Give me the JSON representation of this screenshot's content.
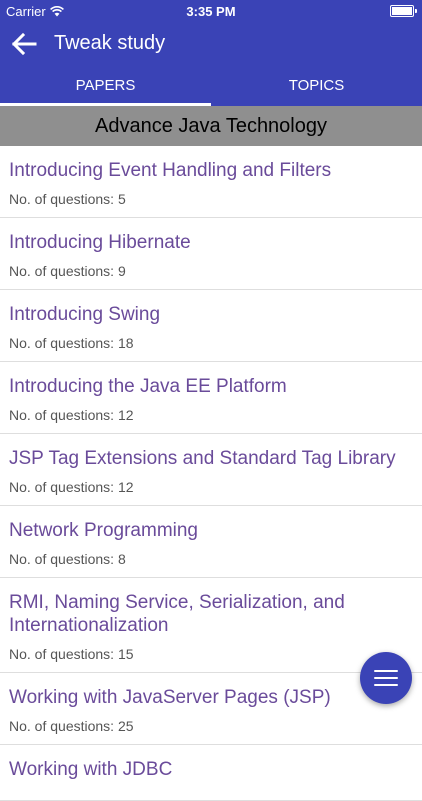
{
  "status_bar": {
    "carrier": "Carrier",
    "time": "3:35 PM"
  },
  "app_bar": {
    "title": "Tweak study",
    "back_icon": "arrow-left-icon"
  },
  "tabs": [
    {
      "label": "PAPERS",
      "active": true
    },
    {
      "label": "TOPICS",
      "active": false
    }
  ],
  "subject": "Advance Java Technology",
  "topics": [
    {
      "name": "Introducing Event Handling and Filters",
      "count": "No. of questions: 5"
    },
    {
      "name": "Introducing Hibernate",
      "count": "No. of questions: 9"
    },
    {
      "name": "Introducing Swing",
      "count": "No. of questions: 18"
    },
    {
      "name": "Introducing the Java EE Platform",
      "count": "No. of questions: 12"
    },
    {
      "name": "JSP Tag Extensions and Standard Tag Library",
      "count": "No. of questions: 12"
    },
    {
      "name": "Network Programming",
      "count": "No. of questions: 8"
    },
    {
      "name": "RMI, Naming Service, Serialization, and Internationalization",
      "count": "No. of questions: 15"
    },
    {
      "name": "Working with JavaServer Pages (JSP)",
      "count": "No. of questions: 25"
    },
    {
      "name": "Working with JDBC",
      "count": ""
    }
  ],
  "fab": {
    "icon": "menu-icon"
  },
  "colors": {
    "primary": "#3a43b6",
    "header_gray": "#8f8f8f",
    "topic_text": "#6a4b9a"
  }
}
